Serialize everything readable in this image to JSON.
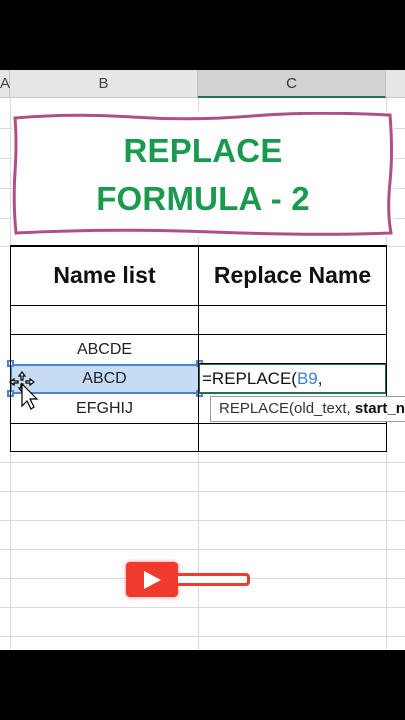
{
  "columns": {
    "a": "A",
    "b": "B",
    "c": "C"
  },
  "title": {
    "line1": "REPLACE",
    "line2": "FORMULA - 2"
  },
  "table": {
    "headers": [
      "Name list",
      "Replace Name"
    ],
    "rows": [
      [
        "",
        ""
      ],
      [
        "ABCDE",
        ""
      ],
      [
        "ABCD",
        ""
      ],
      [
        "EFGHIJ",
        ""
      ],
      [
        "",
        ""
      ]
    ]
  },
  "formula": {
    "prefix": "=REPLACE(",
    "ref": "B9",
    "suffix": ","
  },
  "tooltip": {
    "func": "REPLACE(old_text, ",
    "current_arg": "start_num"
  },
  "colors": {
    "title_green": "#1a9a4f",
    "border_pink": "#b04f86",
    "excel_green": "#217346",
    "selection_blue": "#4a86cf",
    "video_red": "#f03a2e"
  },
  "icons": {
    "cursor": "move-cursor-icon",
    "video": "play-icon"
  }
}
